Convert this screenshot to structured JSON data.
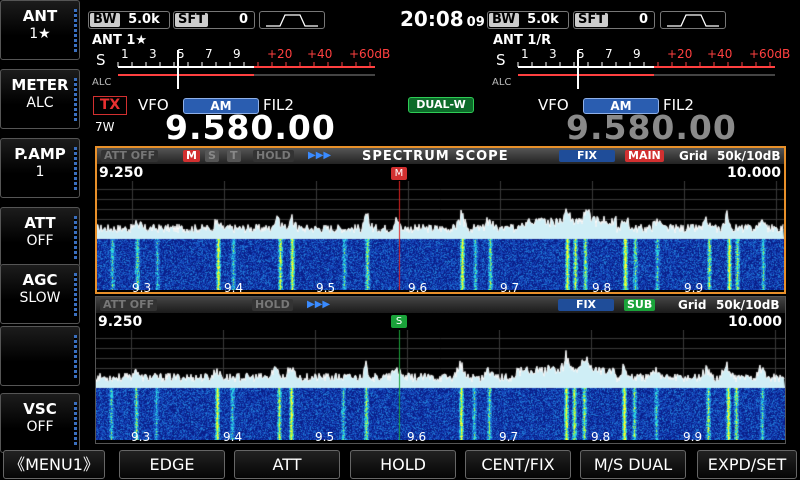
{
  "left_keys": [
    {
      "title": "ANT",
      "value": "1★"
    },
    {
      "title": "METER",
      "value": "ALC"
    },
    {
      "title": "P.AMP",
      "value": "1"
    },
    {
      "title": "ATT",
      "value": "OFF"
    },
    {
      "title": "AGC",
      "value": "SLOW"
    },
    {
      "title": "",
      "value": ""
    },
    {
      "title": "VSC",
      "value": "OFF"
    }
  ],
  "bottom_keys": [
    "《MENU1》",
    "EDGE",
    "ATT",
    "HOLD",
    "CENT/FIX",
    "M/S DUAL",
    "EXPD/SET"
  ],
  "clock": {
    "time": "20:08",
    "seconds": "09"
  },
  "main": {
    "bw_label": "BW",
    "bw_value": "5.0k",
    "sft_label": "SFT",
    "sft_value": "0",
    "ant": "ANT 1★",
    "s_label": "S",
    "alc_label": "ALC",
    "scale": [
      "1",
      "3",
      "5",
      "7",
      "9",
      "+20",
      "+40",
      "+60dB"
    ],
    "tx": "TX",
    "power": "7W",
    "vfo": "VFO",
    "mode": "AM",
    "filter": "FIL2",
    "freq": "9.580.00"
  },
  "sub": {
    "bw_label": "BW",
    "bw_value": "5.0k",
    "sft_label": "SFT",
    "sft_value": "0",
    "ant": "ANT 1/R",
    "s_label": "S",
    "alc_label": "ALC",
    "scale": [
      "1",
      "3",
      "5",
      "7",
      "9",
      "+20",
      "+40",
      "+60dB"
    ],
    "vfo": "VFO",
    "mode": "AM",
    "filter": "FIL2",
    "freq": "9.580.00"
  },
  "dualw": "DUAL-W",
  "scope_main": {
    "att": "ATT OFF",
    "m": "M",
    "s": "S",
    "t": "T",
    "hold": "HOLD",
    "title": "SPECTRUM  SCOPE",
    "fix": "FIX",
    "which": "MAIN",
    "grid": "Grid",
    "span": "50k/10dB",
    "left_freq": "9.250",
    "right_freq": "10.000",
    "marker": "M",
    "ticks": [
      "9.3",
      "9.4",
      "9.5",
      "9.6",
      "9.7",
      "9.8",
      "9.9"
    ]
  },
  "scope_sub": {
    "att": "ATT OFF",
    "hold": "HOLD",
    "fix": "FIX",
    "which": "SUB",
    "grid": "Grid",
    "span": "50k/10dB",
    "left_freq": "9.250",
    "right_freq": "10.000",
    "marker": "S",
    "ticks": [
      "9.3",
      "9.4",
      "9.5",
      "9.6",
      "9.7",
      "9.8",
      "9.9"
    ]
  },
  "colors": {
    "accent_blue": "#2a5db0",
    "main_red": "#d23030",
    "sub_green": "#1aa33a",
    "scope_border": "#e8902a",
    "scale_red": "#ff4040",
    "freq_dim": "#888888"
  }
}
